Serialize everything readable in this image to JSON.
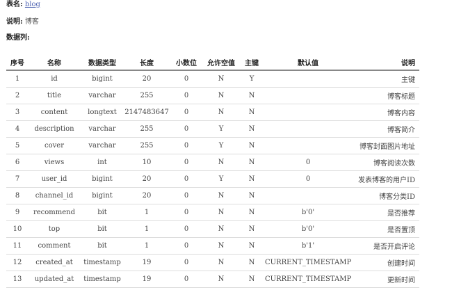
{
  "meta": {
    "table_name_label": "表名:",
    "table_name": "blog",
    "description_label": "说明:",
    "description": "博客",
    "columns_label": "数据列:"
  },
  "table": {
    "headers": [
      "序号",
      "名称",
      "数据类型",
      "长度",
      "小数位",
      "允许空值",
      "主键",
      "默认值",
      "说明"
    ],
    "rows": [
      [
        "1",
        "id",
        "bigint",
        "20",
        "0",
        "N",
        "Y",
        "",
        "主键"
      ],
      [
        "2",
        "title",
        "varchar",
        "255",
        "0",
        "N",
        "N",
        "",
        "博客标题"
      ],
      [
        "3",
        "content",
        "longtext",
        "2147483647",
        "0",
        "N",
        "N",
        "",
        "博客内容"
      ],
      [
        "4",
        "description",
        "varchar",
        "255",
        "0",
        "Y",
        "N",
        "",
        "博客简介"
      ],
      [
        "5",
        "cover",
        "varchar",
        "255",
        "0",
        "Y",
        "N",
        "",
        "博客封面图片地址"
      ],
      [
        "6",
        "views",
        "int",
        "10",
        "0",
        "N",
        "N",
        "0",
        "博客阅读次数"
      ],
      [
        "7",
        "user_id",
        "bigint",
        "20",
        "0",
        "Y",
        "N",
        "0",
        "发表博客的用户ID"
      ],
      [
        "8",
        "channel_id",
        "bigint",
        "20",
        "0",
        "N",
        "N",
        "",
        "博客分类ID"
      ],
      [
        "9",
        "recommend",
        "bit",
        "1",
        "0",
        "N",
        "N",
        "b'0'",
        "是否推荐"
      ],
      [
        "10",
        "top",
        "bit",
        "1",
        "0",
        "N",
        "N",
        "b'0'",
        "是否置顶"
      ],
      [
        "11",
        "comment",
        "bit",
        "1",
        "0",
        "N",
        "N",
        "b'1'",
        "是否开启评论"
      ],
      [
        "12",
        "created_at",
        "timestamp",
        "19",
        "0",
        "N",
        "N",
        "CURRENT_TIMESTAMP",
        "创建时间"
      ],
      [
        "13",
        "updated_at",
        "timestamp",
        "19",
        "0",
        "N",
        "N",
        "CURRENT_TIMESTAMP",
        "更新时间"
      ]
    ]
  }
}
